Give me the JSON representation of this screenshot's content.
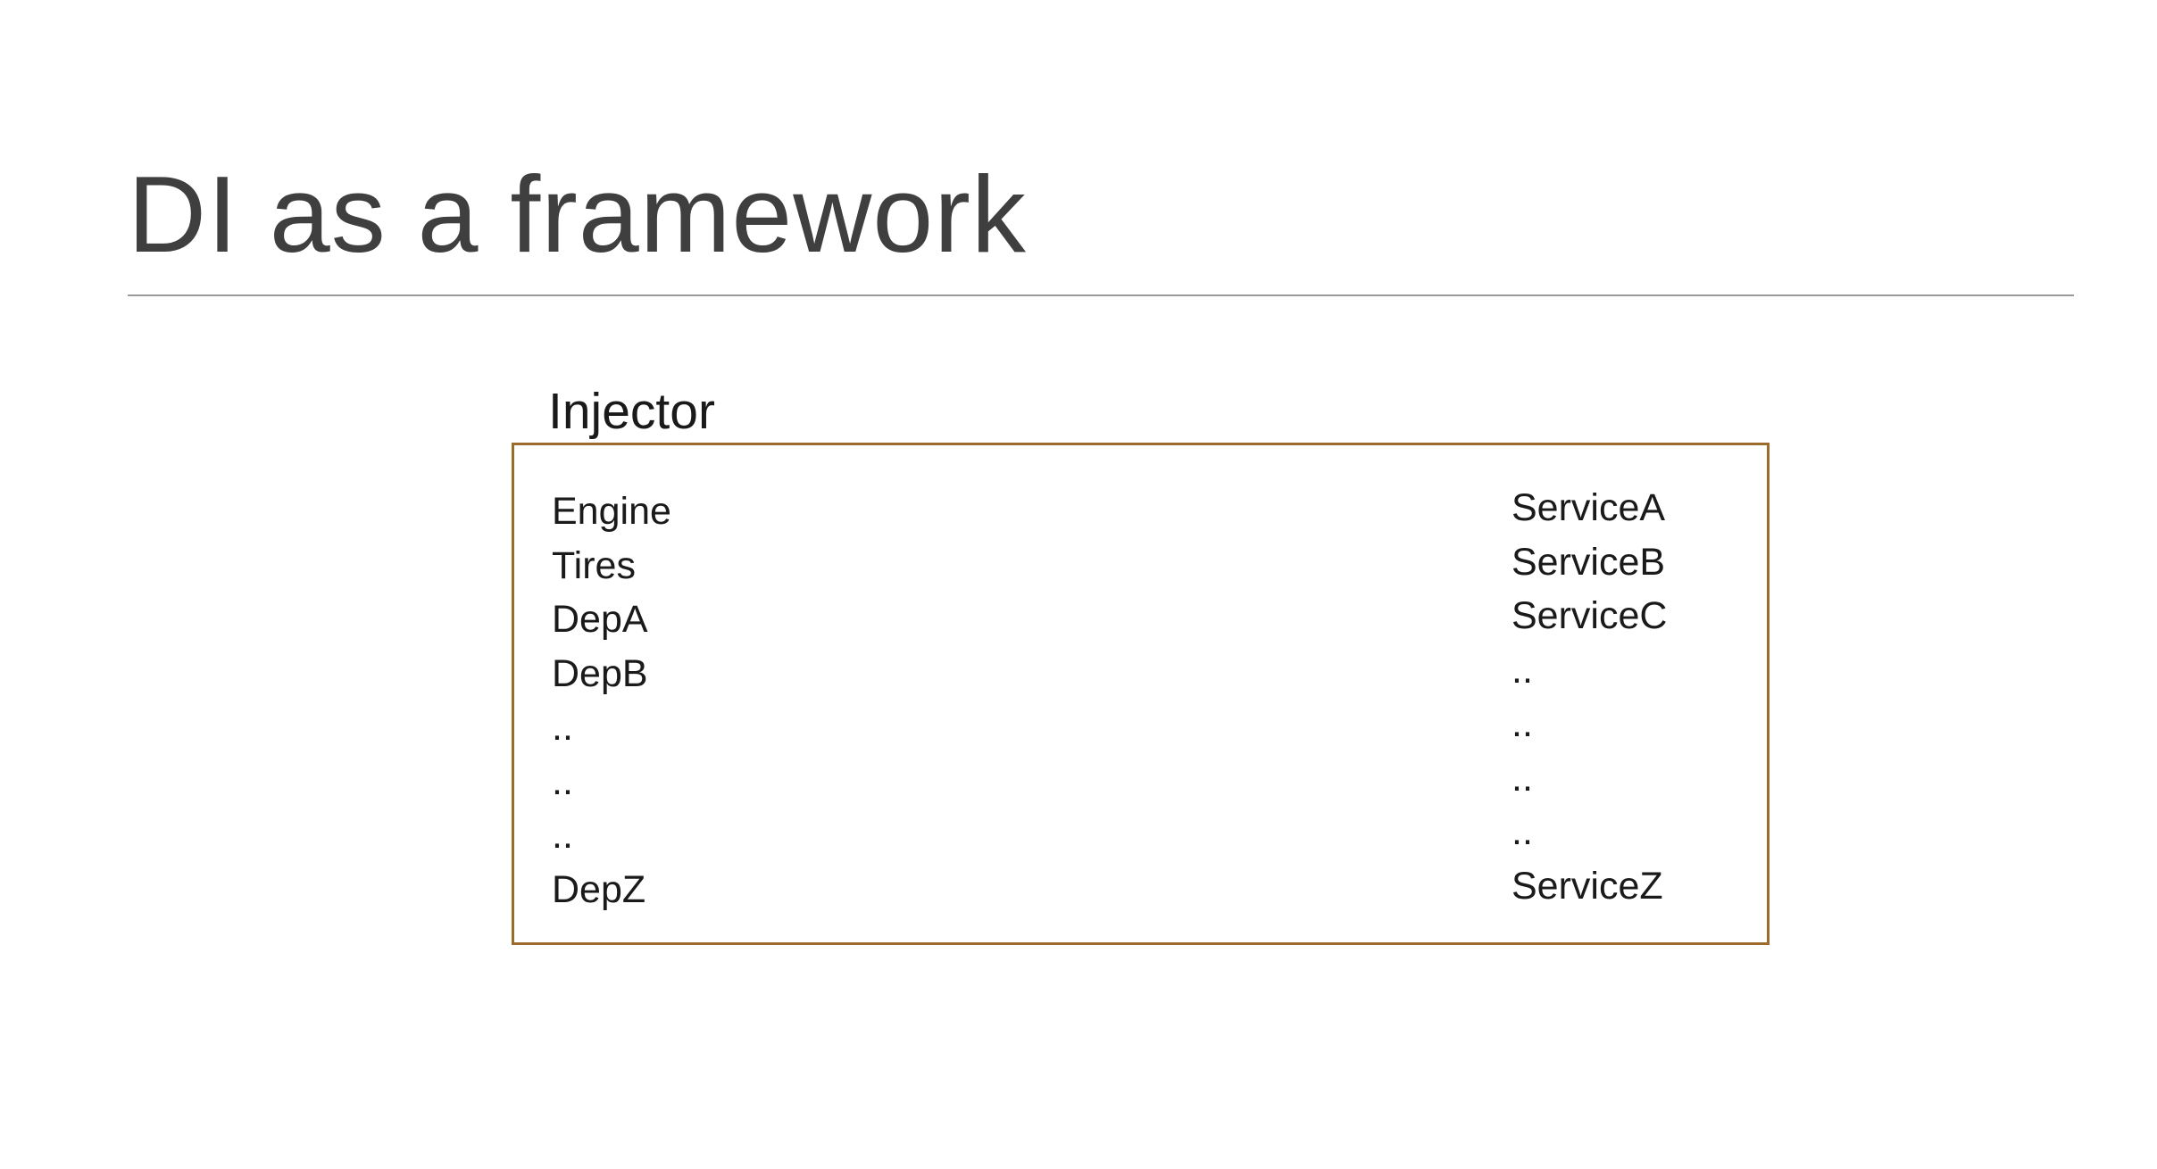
{
  "slide": {
    "title": "DI as a framework"
  },
  "diagram": {
    "box_label": "Injector",
    "border_color": "#9c6a2a",
    "left_column": [
      "Engine",
      "Tires",
      "DepA",
      "DepB",
      "..",
      "..",
      "..",
      "DepZ"
    ],
    "right_column": [
      "ServiceA",
      "ServiceB",
      "ServiceC",
      "..",
      "..",
      "..",
      "..",
      "ServiceZ"
    ]
  }
}
